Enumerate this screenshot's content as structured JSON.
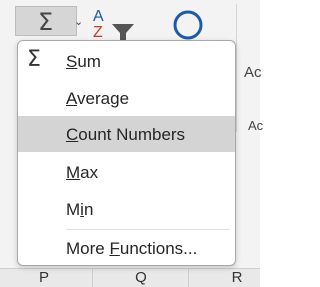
{
  "ribbon": {
    "autosum_symbol": "Σ",
    "autosum_chevron": "⌄",
    "side_label_top": "Ac",
    "side_label_bottom": "Ac"
  },
  "menu": {
    "items": [
      {
        "icon": "Σ",
        "underline": "S",
        "rest": "um",
        "label": "Sum",
        "selected": false
      },
      {
        "icon": "",
        "underline": "A",
        "rest": "verage",
        "label": "Average",
        "selected": false
      },
      {
        "icon": "",
        "underline": "C",
        "rest": "ount Numbers",
        "label": "Count Numbers",
        "selected": true
      },
      {
        "icon": "",
        "underline": "M",
        "rest": "ax",
        "label": "Max",
        "selected": false
      },
      {
        "icon": "",
        "pre": "M",
        "underline": "i",
        "rest": "n",
        "label": "Min",
        "selected": false
      },
      {
        "icon": "",
        "pre": "More ",
        "underline": "F",
        "rest": "unctions...",
        "label": "More Functions...",
        "selected": false
      }
    ]
  },
  "columns": [
    "P",
    "Q",
    "R"
  ],
  "colors": {
    "selected_bg": "#d4d4d4",
    "ribbon_bg": "#f3f3f3",
    "find_circle": "#1e5aa8",
    "sort_a": "#1e5aa8",
    "sort_z": "#c0392b"
  }
}
